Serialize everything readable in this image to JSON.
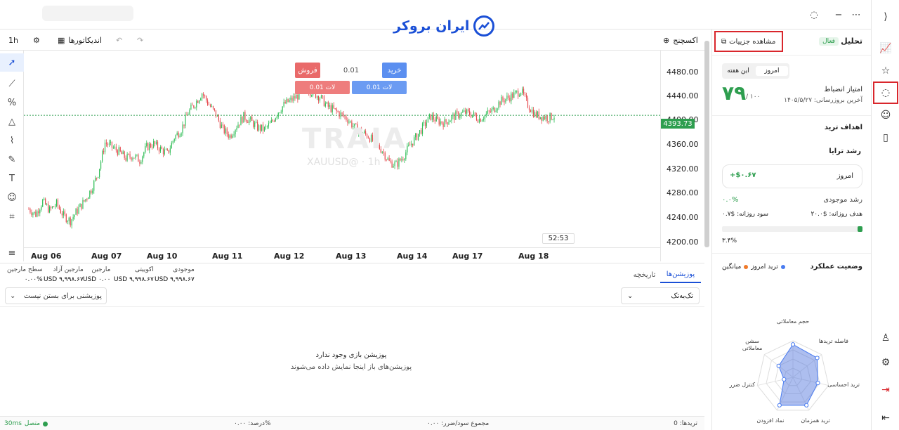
{
  "header": {
    "logo_text": "ایران بروکر"
  },
  "toolbar": {
    "timeframe": "1h",
    "indicators": "اندیکاتورها",
    "exchange": "اکسچنج"
  },
  "chart_data": {
    "type": "candlestick",
    "symbol": "XAUUSD@ · 1h",
    "watermark": "TRAIA",
    "x_ticks": [
      "Aug 06",
      "Aug 07",
      "Aug 10",
      "Aug 11",
      "Aug 12",
      "Aug 13",
      "Aug 14",
      "Aug 17",
      "Aug 18"
    ],
    "y_ticks": [
      "4480.00",
      "4440.00",
      "4400.00",
      "4360.00",
      "4320.00",
      "4280.00",
      "4240.00",
      "4200.00"
    ],
    "ylim": [
      4200,
      4480
    ],
    "last_price": "4393.73",
    "close_path": [
      4250,
      4242,
      4262,
      4248,
      4258,
      4240,
      4232,
      4248,
      4262,
      4280,
      4305,
      4352,
      4345,
      4338,
      4328,
      4332,
      4325,
      4345,
      4350,
      4342,
      4335,
      4360,
      4372,
      4398,
      4412,
      4428,
      4410,
      4395,
      4372,
      4362,
      4378,
      4392,
      4385,
      4375,
      4372,
      4382,
      4400,
      4412,
      4418,
      4425,
      4435,
      4428,
      4422,
      4408,
      4402,
      4395,
      4388,
      4375,
      4368,
      4362,
      4350,
      4340,
      4322,
      4318,
      4330,
      4348,
      4362,
      4378,
      4392,
      4385,
      4382,
      4390,
      4395,
      4398,
      4395,
      4388,
      4395,
      4402,
      4415,
      4420,
      4425,
      4432,
      4410,
      4395,
      4392,
      4390,
      4393.73
    ]
  },
  "trade": {
    "buy": "خرید",
    "sell": "فروش",
    "qty": "0.01",
    "lot_sell": "لات 0.01",
    "lot_buy": "لات 0.01"
  },
  "timer": "52:53",
  "positions": {
    "tab_positions": "پوزیشن‌ها",
    "tab_history": "تاریخچه",
    "filter": "تک‌به‌تک",
    "close_btn": "پوزیشنی برای بستن نیست",
    "empty_title": "پوزیشن بازی وجود ندارد",
    "empty_sub": "پوزیشن‌های باز اینجا نمایش داده می‌شوند",
    "stats": [
      {
        "label": "موجودی",
        "value": "USD ۹,۹۹۸.۶۷"
      },
      {
        "label": "اکوییتی",
        "value": "USD ۹,۹۹۸.۶۷"
      },
      {
        "label": "مارجین",
        "value": "USD ۰.۰۰"
      },
      {
        "label": "مارجین آزاد",
        "value": "USD ۹,۹۹۸.۶۷"
      },
      {
        "label": "سطح مارجین",
        "value": "۰.۰۰%"
      }
    ]
  },
  "status": {
    "trades": "تریدها: 0",
    "pnl": "مجموع سود/ضرر: ۰.۰۰",
    "percent": "درصد: ۰.۰۰%",
    "connection": "متصل",
    "latency": "30ms"
  },
  "panel": {
    "title": "تحلیل",
    "badge": "فعال",
    "details": "مشاهده جزییات",
    "seg_today": "امروز",
    "seg_week": "این هفته",
    "score_label": "امتیاز انضباط",
    "score_value": "۷۹",
    "score_max": "/ ۱۰۰",
    "updated": "آخرین بروزرسانی: ۱۴۰۵/۵/۲۷",
    "goals": "اهداف ترید",
    "growth": "رشد ترایا",
    "today_label": "امروز",
    "today_value": "+$۰.۶۷",
    "balance_growth": "رشد موجودی",
    "balance_growth_val": "۰.۰%",
    "daily_target": "هدف روزانه: $۲۰.۰",
    "daily_profit": "سود روزانه: $۰.۷",
    "progress_label": "۳.۴%",
    "progress": 0.034,
    "perf_title": "وضعیت عملکرد",
    "legend_today": "ترید امروز",
    "legend_avg": "میانگین",
    "radar": {
      "axes": [
        "حجم معاملاتی",
        "فاصله تریدها",
        "ترید احساسی",
        "ترید همزمان",
        "نماد افزودن",
        "کنترل ضرر",
        "سشن معاملاتی"
      ],
      "values": [
        0.9,
        0.85,
        0.7,
        0.85,
        0.85,
        0.25,
        0.5
      ]
    }
  }
}
